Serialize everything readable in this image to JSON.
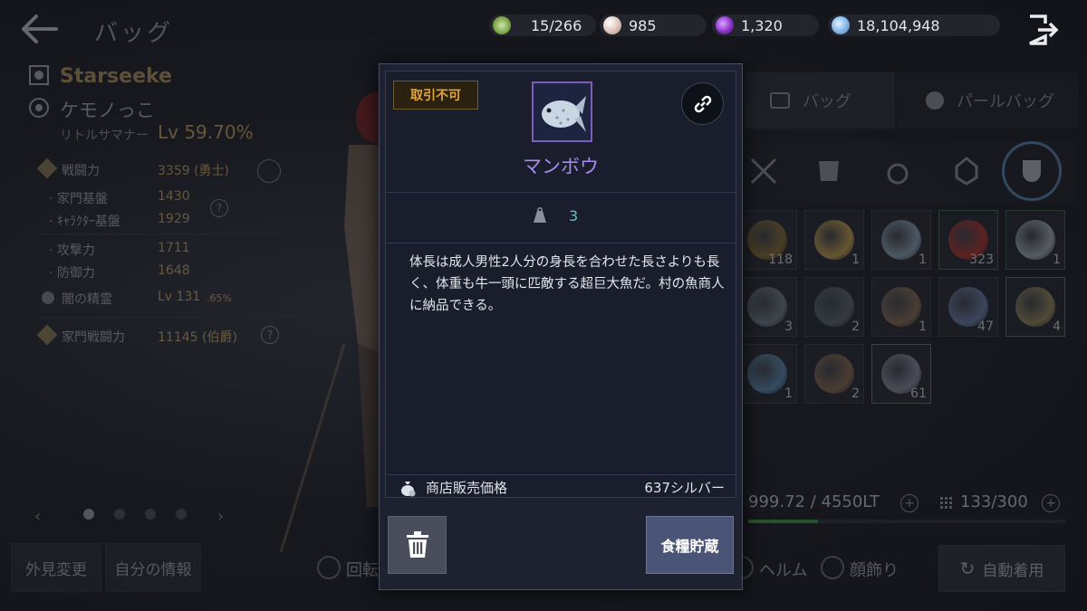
{
  "header": {
    "title": "バッグ"
  },
  "currencies": [
    {
      "name": "weight-slots",
      "value": "15/266",
      "color": "#8bc34a"
    },
    {
      "name": "pearl",
      "value": "985",
      "color": "#e8d6cf"
    },
    {
      "name": "purple-crystal",
      "value": "1,320",
      "color": "#9b3fd6"
    },
    {
      "name": "silver",
      "value": "18,104,948",
      "color": "#7fb4e6"
    }
  ],
  "character": {
    "name": "Starseeke",
    "family": "ケモノっこ",
    "class": "リトルサマナー",
    "level": "Lv 59.70%",
    "stats": [
      {
        "label": "戦闘力",
        "value": "3359 (勇士)"
      },
      {
        "label": "· 家門基盤",
        "value": "1430"
      },
      {
        "label": "· ｷｬﾗｸﾀｰ基盤",
        "value": "1929"
      },
      {
        "label": "· 攻撃力",
        "value": "1711"
      },
      {
        "label": "· 防御力",
        "value": "1648"
      },
      {
        "label": "闇の精霊",
        "value": "Lv 131",
        "suffix": ".65%"
      },
      {
        "label": "家門戦闘力",
        "value": "11145 (伯爵)"
      }
    ],
    "qmark": "?"
  },
  "bottom": {
    "appearance_btn": "外見変更",
    "info_btn": "自分の情報",
    "rotate_label": "回転",
    "helm_label": "ヘルム",
    "accessory_label": "顔飾り",
    "auto_equip_btn": "自動着用"
  },
  "bag": {
    "tabs": [
      "バッグ",
      "パールバッグ"
    ],
    "slots": [
      {
        "item": "maze-box",
        "count": "118",
        "color": "#8a6b2a",
        "border": "normal"
      },
      {
        "item": "orb",
        "count": "1",
        "color": "#c9a14a",
        "border": "normal"
      },
      {
        "item": "sunfish",
        "count": "1",
        "color": "#8fa5b6",
        "border": "normal"
      },
      {
        "item": "hp-potion",
        "count": "323",
        "color": "#b5302a",
        "border": "green"
      },
      {
        "item": "fish",
        "count": "1",
        "color": "#a9b3bc",
        "border": "green"
      },
      {
        "item": "fish",
        "count": "3",
        "color": "#6d7c86",
        "border": "normal"
      },
      {
        "item": "tuna",
        "count": "2",
        "color": "#5a6670",
        "border": "normal"
      },
      {
        "item": "ray",
        "count": "1",
        "color": "#8a6d52",
        "border": "normal"
      },
      {
        "item": "pet-food",
        "count": "47",
        "color": "#6b7fa8",
        "border": "normal"
      },
      {
        "item": "fish",
        "count": "4",
        "color": "#9a8a5a",
        "border": "grey"
      },
      {
        "item": "jellyfish",
        "count": "1",
        "color": "#5a8ab0",
        "border": "normal"
      },
      {
        "item": "flatfish",
        "count": "2",
        "color": "#8a6a4a",
        "border": "normal"
      },
      {
        "item": "pet-food",
        "count": "61",
        "color": "#8a8fa0",
        "border": "grey"
      }
    ],
    "weight": "999.72 / 4550LT",
    "slot_count": "133/300",
    "weight_fraction": 0.22,
    "plus": "+"
  },
  "tooltip": {
    "badge": "取引不可",
    "item_name": "マンボウ",
    "weight_value": "3",
    "description": "体長は成人男性2人分の身長を合わせた長さよりも長く、体重も牛一頭に匹敵する超巨大魚だ。村の魚商人に納品できる。",
    "price_label": "商店販売価格",
    "price_value": "637シルバー",
    "store_button": "食糧貯蔵",
    "name_color": "#a68bf0"
  }
}
